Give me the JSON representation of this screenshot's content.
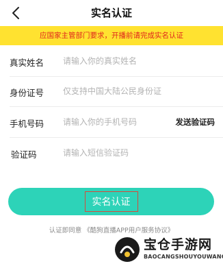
{
  "nav": {
    "back_icon": "chevron-left-icon",
    "title": "实名认证"
  },
  "notice": {
    "text": "应国家主管部门要求，开播前请完成实名认证",
    "background": "#ffe230",
    "color": "#e0261d"
  },
  "form": {
    "name": {
      "label": "真实姓名",
      "placeholder": "请输入你的真实姓名",
      "value": ""
    },
    "id_number": {
      "label": "身份证号",
      "placeholder": "仅支持中国大陆公民身份证",
      "value": ""
    },
    "phone": {
      "label": "手机号码",
      "placeholder": "请输入你的手机号码",
      "value": "",
      "send_code_label": "发送验证码"
    },
    "code": {
      "label": "验证码",
      "placeholder": "请输入短信验证码",
      "value": ""
    }
  },
  "submit": {
    "label": "实名认证",
    "color": "#2dd3b8"
  },
  "agreement": {
    "prefix": "认证即同意",
    "link": "《酷狗直播APP用户服务协议》"
  },
  "watermark": {
    "name": "宝仓手游网",
    "domain": "BAOCANGSHOUYOUWANG"
  }
}
